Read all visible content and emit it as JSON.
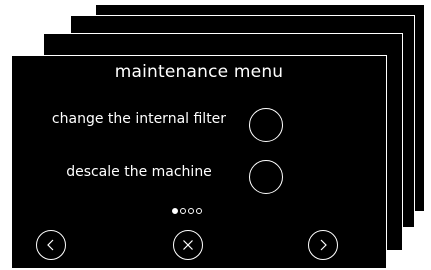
{
  "screen": {
    "title": "maintenance menu",
    "options": [
      {
        "label": "change the internal filter"
      },
      {
        "label": "descale the machine"
      }
    ],
    "pagination": {
      "current": 1,
      "total": 4
    },
    "nav": {
      "prev_icon": "chevron-left-icon",
      "close_icon": "close-icon",
      "next_icon": "chevron-right-icon"
    }
  },
  "colors": {
    "background": "#000000",
    "foreground": "#ffffff",
    "page": "#ffffff"
  }
}
